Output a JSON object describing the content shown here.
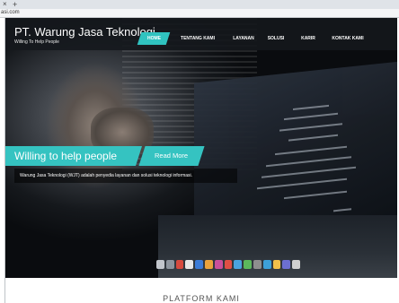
{
  "browser": {
    "tab_close_glyph": "×",
    "tab_new_glyph": "+",
    "url": "asi.com"
  },
  "header": {
    "brand_title": "PT. Warung Jasa Teknologi",
    "brand_subtitle": "Willing To Help People",
    "nav": [
      {
        "label": "HOME",
        "active": true
      },
      {
        "label": "TENTANG KAMI",
        "active": false
      },
      {
        "label": "LAYANAN",
        "active": false
      },
      {
        "label": "SOLUSI",
        "active": false
      },
      {
        "label": "KARIR",
        "active": false
      },
      {
        "label": "KONTAK KAMI",
        "active": false
      }
    ]
  },
  "slider": {
    "headline": "Willing to help people",
    "read_more": "Read More",
    "description": "Warung Jasa Teknologi (WJT) adalah penyedia layanan dan solusi teknologi informasi."
  },
  "section": {
    "title": "PLATFORM KAMI"
  },
  "colors": {
    "accent": "#35c3c1",
    "header_bg": "#14181c"
  }
}
